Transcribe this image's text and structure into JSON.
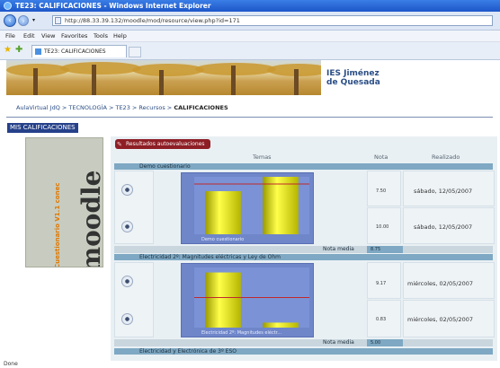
{
  "window": {
    "title": "TE23: CALIFICACIONES - Windows Internet Explorer"
  },
  "address_bar": {
    "url": "http://88.33.39.132/moodle/mod/resource/view.php?id=171"
  },
  "menu": {
    "items": [
      "File",
      "Edit",
      "View",
      "Favorites",
      "Tools",
      "Help"
    ]
  },
  "tab": {
    "title": "TE23: CALIFICACIONES"
  },
  "header": {
    "school_line1": "IES Jiménez",
    "school_line2": "de Quesada"
  },
  "breadcrumb": {
    "path": "AulaVirtual JdQ > TECNOLOGÍA > TE23 > Recursos > ",
    "current": "CALIFICACIONES"
  },
  "page": {
    "title": "MIS CALIFICACIONES"
  },
  "sidebar": {
    "logo_text": "moodle",
    "caption": "Cuestionario V1.1 conec"
  },
  "results": {
    "header": "Resultados autoevaluaciones",
    "columns": {
      "temas": "Temas",
      "nota": "Nota",
      "realizado": "Realizado"
    },
    "groups": [
      {
        "name": "Demo cuestionario",
        "average_label": "Nota media",
        "average": "8.75",
        "chart_caption": "Demo cuestionario",
        "rows": [
          {
            "nota": "7.50",
            "date": "sábado, 12/05/2007"
          },
          {
            "nota": "10.00",
            "date": "sábado, 12/05/2007"
          }
        ]
      },
      {
        "name": "Electricidad 2º: Magnitudes eléctricas y Ley de Ohm",
        "average_label": "Nota media",
        "average": "5.00",
        "chart_caption": "Electricidad 2º: Magnitudes eléctr...",
        "rows": [
          {
            "nota": "9.17",
            "date": "miércoles, 02/05/2007"
          },
          {
            "nota": "0.83",
            "date": "miércoles, 02/05/2007"
          }
        ]
      },
      {
        "name": "Electricidad y Electrónica de 3º ESO"
      }
    ]
  },
  "status_bar": {
    "text": "Done"
  }
}
